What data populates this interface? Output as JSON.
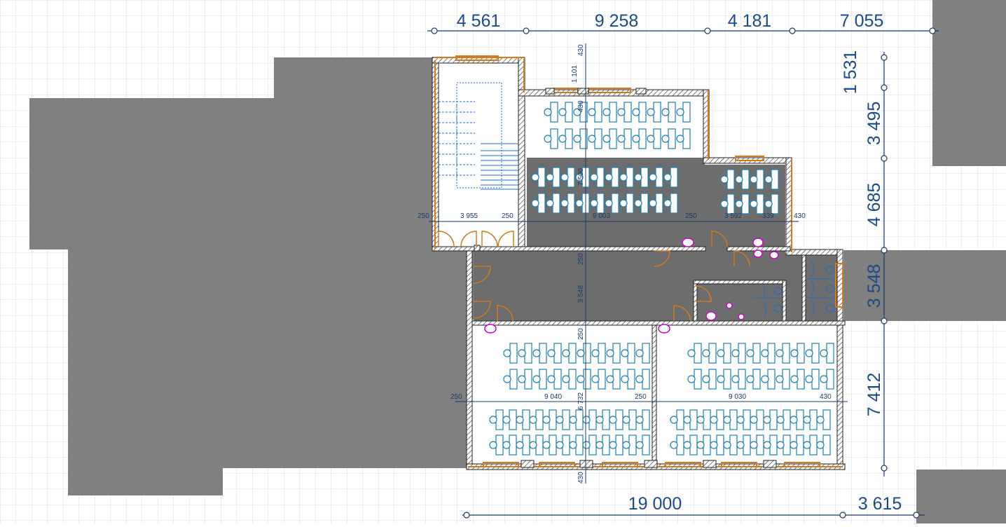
{
  "dimensions_top": [
    "4 561",
    "9 258",
    "4 181",
    "7 055"
  ],
  "dimensions_right": [
    "1 531",
    "3 495",
    "4 685",
    "3 548",
    "7 412"
  ],
  "dimensions_bottom": [
    "19 000",
    "3 615"
  ],
  "labels_upper": {
    "w250a": "250",
    "w3955": "3 955",
    "w250b": "250",
    "w9003": "9 003",
    "w250c": "250",
    "w3592": "3 592",
    "w339": "339",
    "w430": "430",
    "v430": "430",
    "v1101": "1 101",
    "v430b": "430",
    "v7500": "7 500"
  },
  "labels_middle": {
    "v250a": "250",
    "v3548": "3 548",
    "v250b": "250"
  },
  "labels_lower": {
    "w250a": "250",
    "w9040": "9 040",
    "w250b": "250",
    "w9030": "9 030",
    "w430": "430",
    "v6732": "6 732",
    "v430": "430"
  },
  "colors": {
    "grid": "#d9d9d9",
    "neighbor": "#808080",
    "floor": "#6d6d6d",
    "wall_outline": "#d47a1e",
    "furniture": "#1a7fb0",
    "dimension": "#1a4a8c",
    "plumbing": "#cc00cc"
  }
}
